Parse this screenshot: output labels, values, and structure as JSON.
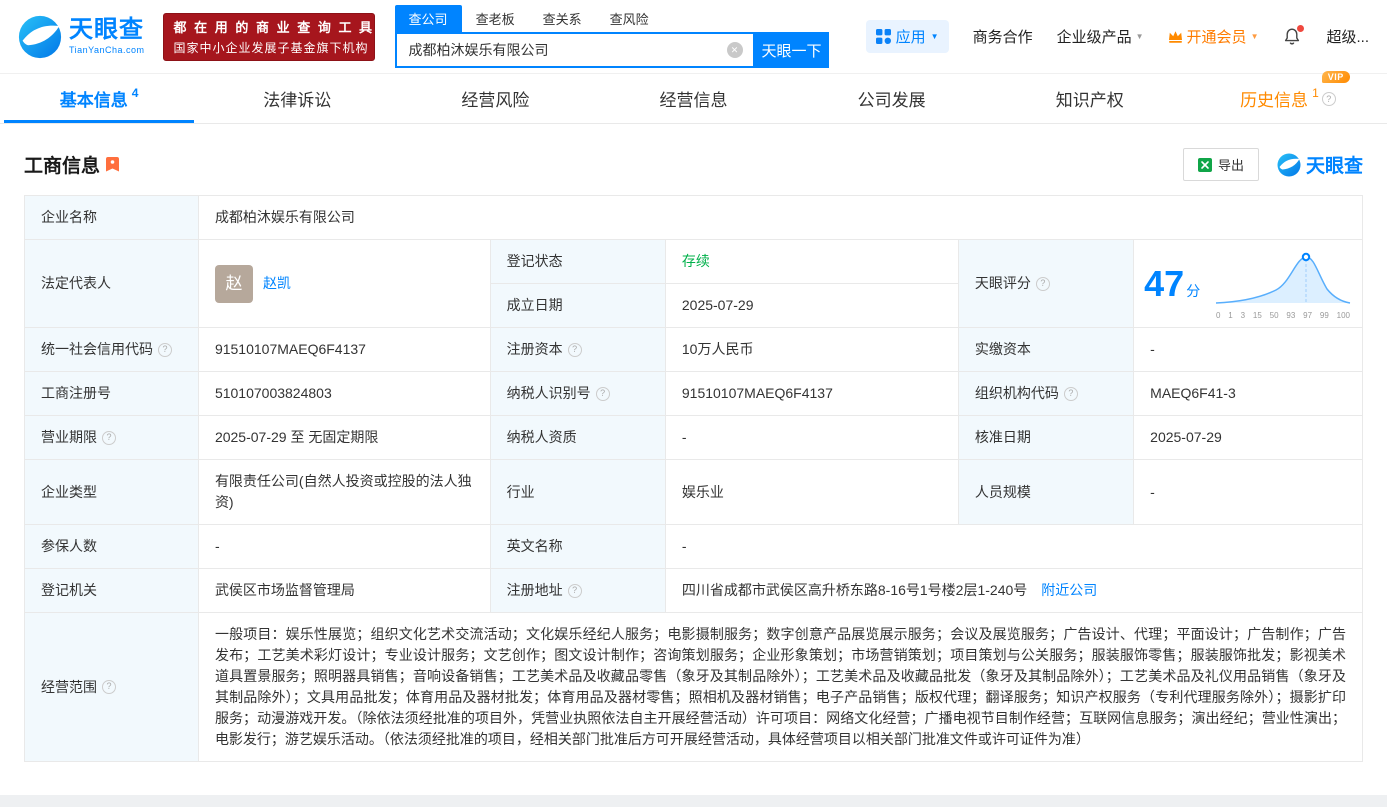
{
  "colors": {
    "brand_blue": "#0084ff",
    "banner_red": "#a6161d",
    "member_orange": "#ff7c00",
    "history_tab_orange": "#ff8a00",
    "status_green": "#00b04a",
    "label_cell_bg": "#f2f9fd"
  },
  "header": {
    "logo_title": "天眼查",
    "logo_sub": "TianYanCha.com",
    "banner_line1": "都 在 用 的 商 业 查 询 工 具",
    "banner_line2": "国家中小企业发展子基金旗下机构",
    "search_tabs": [
      "查公司",
      "查老板",
      "查关系",
      "查风险"
    ],
    "search_value": "成都柏沐娱乐有限公司",
    "search_button": "天眼一下",
    "app_menu": "应用",
    "nav_cooperation": "商务合作",
    "nav_enterprise": "企业级产品",
    "nav_vip": "开通会员",
    "nav_super": "超级..."
  },
  "tabs": {
    "basic": "基本信息",
    "basic_count": "4",
    "legal": "法律诉讼",
    "risk": "经营风险",
    "operating": "经营信息",
    "development": "公司发展",
    "ip": "知识产权",
    "history": "历史信息",
    "history_count": "1",
    "vip_badge": "VIP"
  },
  "section": {
    "title": "工商信息",
    "export_label": "导出",
    "brand": "天眼查"
  },
  "score": {
    "label": "天眼评分",
    "value": "47",
    "unit": "分",
    "axis": [
      "0",
      "1",
      "3",
      "15",
      "50",
      "93",
      "97",
      "99",
      "100"
    ]
  },
  "info": {
    "company_name_label": "企业名称",
    "company_name": "成都柏沐娱乐有限公司",
    "legal_rep_label": "法定代表人",
    "legal_rep_avatar": "赵",
    "legal_rep_name": "赵凯",
    "reg_status_label": "登记状态",
    "reg_status": "存续",
    "establish_label": "成立日期",
    "establish_date": "2025-07-29",
    "credit_code_label": "统一社会信用代码",
    "credit_code": "91510107MAEQ6F4137",
    "reg_capital_label": "注册资本",
    "reg_capital": "10万人民币",
    "paid_capital_label": "实缴资本",
    "paid_capital": "-",
    "reg_number_label": "工商注册号",
    "reg_number": "510107003824803",
    "taxpayer_id_label": "纳税人识别号",
    "taxpayer_id": "91510107MAEQ6F4137",
    "org_code_label": "组织机构代码",
    "org_code": "MAEQ6F41-3",
    "term_label": "营业期限",
    "term": "2025-07-29 至 无固定期限",
    "taxpayer_quality_label": "纳税人资质",
    "taxpayer_quality": "-",
    "approve_date_label": "核准日期",
    "approve_date": "2025-07-29",
    "company_type_label": "企业类型",
    "company_type": "有限责任公司(自然人投资或控股的法人独资)",
    "industry_label": "行业",
    "industry": "娱乐业",
    "staff_size_label": "人员规模",
    "staff_size": "-",
    "insured_label": "参保人数",
    "insured": "-",
    "english_name_label": "英文名称",
    "english_name": "-",
    "authority_label": "登记机关",
    "authority": "武侯区市场监督管理局",
    "address_label": "注册地址",
    "address": "四川省成都市武侯区高升桥东路8-16号1号楼2层1-240号",
    "nearby_link": "附近公司",
    "scope_label": "经营范围",
    "scope": "一般项目：娱乐性展览；组织文化艺术交流活动；文化娱乐经纪人服务；电影摄制服务；数字创意产品展览展示服务；会议及展览服务；广告设计、代理；平面设计；广告制作；广告发布；工艺美术彩灯设计；专业设计服务；文艺创作；图文设计制作；咨询策划服务；企业形象策划；市场营销策划；项目策划与公关服务；服装服饰零售；服装服饰批发；影视美术道具置景服务；照明器具销售；音响设备销售；工艺美术品及收藏品零售（象牙及其制品除外）；工艺美术品及收藏品批发（象牙及其制品除外）；工艺美术品及礼仪用品销售（象牙及其制品除外）；文具用品批发；体育用品及器材批发；体育用品及器材零售；照相机及器材销售；电子产品销售；版权代理；翻译服务；知识产权服务（专利代理服务除外）；摄影扩印服务；动漫游戏开发。（除依法须经批准的项目外，凭营业执照依法自主开展经营活动）许可项目：网络文化经营；广播电视节目制作经营；互联网信息服务；演出经纪；营业性演出；电影发行；游艺娱乐活动。（依法须经批准的项目，经相关部门批准后方可开展经营活动，具体经营项目以相关部门批准文件或许可证件为准）"
  }
}
